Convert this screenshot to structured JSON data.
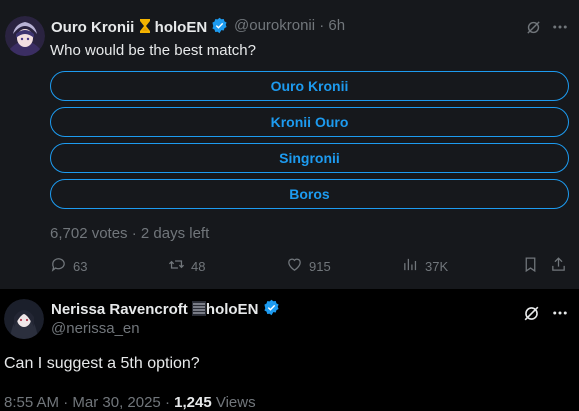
{
  "parent_tweet": {
    "author_name": "Ouro Kronii",
    "author_suffix": "holoEN",
    "handle": "@ourokronii",
    "time": "· 6h",
    "question": "Who would be the best match?",
    "options": [
      "Ouro Kronii",
      "Kronii Ouro",
      "Singronii",
      "Boros"
    ],
    "poll_meta": "6,702 votes · 2 days left",
    "actions": {
      "replies": "63",
      "reposts": "48",
      "likes": "915",
      "views": "37K"
    }
  },
  "reply_tweet": {
    "author_name": "Nerissa Ravencroft",
    "author_suffix": "holoEN",
    "handle": "@nerissa_en",
    "text": "Can I suggest a 5th option?",
    "time": "8:55 AM",
    "date": "Mar 30, 2025",
    "views_count": "1,245",
    "views_label": "Views"
  },
  "colors": {
    "accent": "#1d9bf0",
    "muted": "#71767b",
    "text": "#e7e9ea",
    "parent_bg": "#16181c",
    "reply_bg": "#000000"
  },
  "icons": {
    "grok": "grok-icon",
    "more": "more-icon",
    "reply": "reply-icon",
    "repost": "repost-icon",
    "like": "like-icon",
    "views": "views-icon",
    "bookmark": "bookmark-icon",
    "share": "share-icon",
    "verified": "verified-icon",
    "hourglass": "hourglass-icon"
  }
}
